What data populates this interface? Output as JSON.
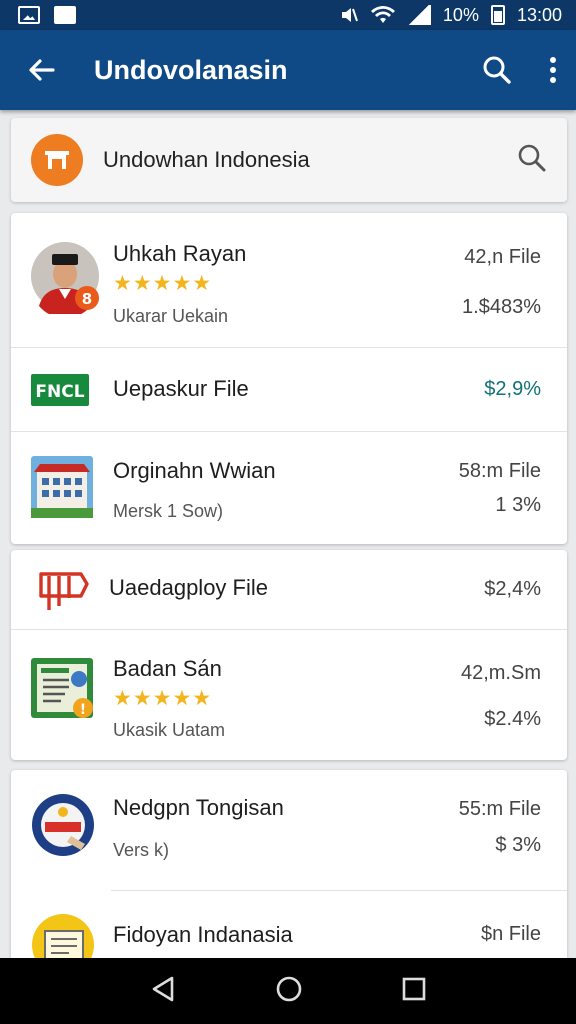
{
  "status_bar": {
    "battery": "10%",
    "time": "13:00",
    "left_icons": [
      "gallery-icon",
      "message-icon"
    ],
    "right_icons": [
      "mute-icon",
      "wifi-icon",
      "signal-icon",
      "battery-icon"
    ]
  },
  "app_bar": {
    "title": "Undovolanasin",
    "back_icon": "back-arrow-icon",
    "search_icon": "search-icon",
    "menu_icon": "more-vert-icon"
  },
  "search_card": {
    "label": "Undowhan Indonesia",
    "logo_icon": "brand-logo-icon",
    "search_icon": "search-icon"
  },
  "items": [
    {
      "name": "Uhkah Rayan",
      "rating": 5,
      "sub": "Ukarar Uekain",
      "value1": "42,n File",
      "value2": "1.$483%",
      "icon": "profile-avatar",
      "badge": "8"
    },
    {
      "name": "Uepaskur File",
      "value1": "$2,9%",
      "icon": "fncl-logo"
    },
    {
      "name": "Orginahn Wwian",
      "sub": "Mersk 1 Sow)",
      "value1": "58:m File",
      "value2": "1 3%",
      "icon": "building-icon"
    },
    {
      "name": "Uaedagploy File",
      "value1": "$2,4%",
      "icon": "house-outline-icon"
    },
    {
      "name": "Badan Sán",
      "rating": 5,
      "sub": "Ukasik Uatam",
      "value1": "42,m.Sm",
      "value2": "$2.4%",
      "icon": "document-app-icon"
    },
    {
      "name": "Nedgpn Tongisan",
      "sub": "Vers k)",
      "value1": "55:m File",
      "value2": "$ 3%",
      "icon": "seal-badge-icon"
    },
    {
      "name": "Fidoyan Indanasia",
      "value1": "$n File",
      "icon": "yellow-doc-icon"
    }
  ],
  "nav_bar": {
    "back_icon": "nav-back-icon",
    "home_icon": "nav-home-icon",
    "recents_icon": "nav-recents-icon"
  },
  "colors": {
    "app_bar": "#0f4a86",
    "status_bar": "#0d3766",
    "accent_teal": "#12707a",
    "star": "#f2b51d",
    "brand_orange": "#ee7d22"
  }
}
